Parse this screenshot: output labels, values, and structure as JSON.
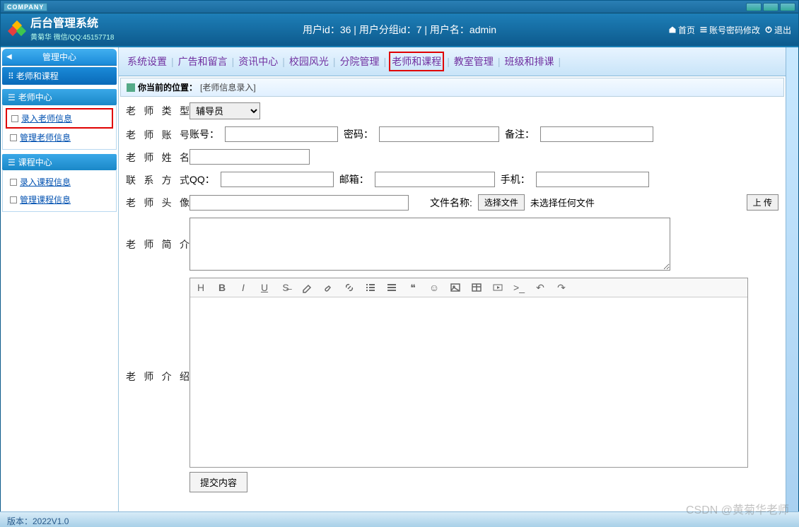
{
  "brand": {
    "company": "COMPANY",
    "title": "后台管理系统",
    "subtitle": "黄菊华 微信/QQ:45157718"
  },
  "user_line": "用户id：36 | 用户分组id：7 | 用户名：admin",
  "header_actions": {
    "home": "首页",
    "pwd": "账号密码修改",
    "logout": "退出"
  },
  "sidebar": {
    "center": "管理中心",
    "module": "老师和课程",
    "groups": [
      {
        "title": "老师中心",
        "items": [
          {
            "label": "录入老师信息",
            "hl": true
          },
          {
            "label": "管理老师信息"
          }
        ]
      },
      {
        "title": "课程中心",
        "items": [
          {
            "label": "录入课程信息"
          },
          {
            "label": "管理课程信息"
          }
        ]
      }
    ]
  },
  "topnav": {
    "items": [
      "系统设置",
      "广告和留言",
      "资讯中心",
      "校园风光",
      "分院管理",
      "老师和课程",
      "教室管理",
      "班级和排课"
    ],
    "hl_index": 5
  },
  "breadcrumb": {
    "prefix": "你当前的位置：",
    "path": "[老师信息录入]"
  },
  "form": {
    "type_label": "老师类型",
    "type_option": "辅导员",
    "acct_label": "老师账号",
    "acct_sub": {
      "acct": "账号：",
      "pwd": "密码：",
      "note": "备注："
    },
    "name_label": "老师姓名",
    "contact_label": "联系方式",
    "contact_sub": {
      "qq": "QQ：",
      "email": "邮箱：",
      "phone": "手机："
    },
    "avatar_label": "老师头像",
    "file_name_label": "文件名称:",
    "choose_file": "选择文件",
    "no_file": "未选择任何文件",
    "upload_btn": "上 传",
    "bio_label": "老师简介",
    "intro_label": "老师介绍",
    "submit": "提交内容"
  },
  "footer": {
    "version": "版本：2022V1.0"
  },
  "watermark": "CSDN @黄菊华老师"
}
